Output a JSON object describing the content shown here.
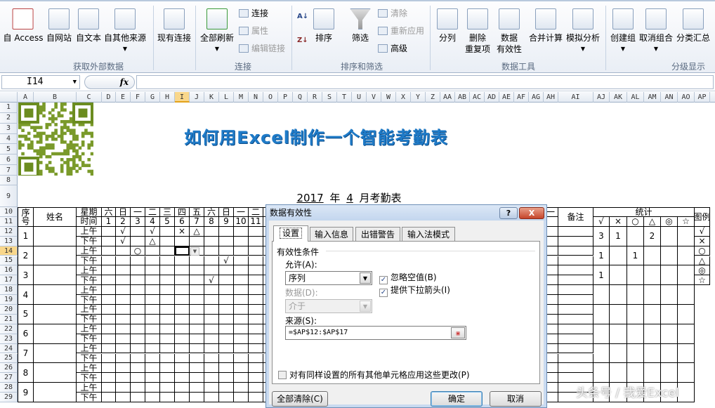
{
  "ribbon": {
    "buttons": [
      {
        "id": "from-access",
        "label": "自 Access"
      },
      {
        "id": "from-web",
        "label": "自网站"
      },
      {
        "id": "from-text",
        "label": "自文本"
      },
      {
        "id": "from-other",
        "label": "自其他来源"
      },
      {
        "id": "existing-connections",
        "label": "现有连接"
      },
      {
        "id": "refresh-all",
        "label": "全部刷新"
      },
      {
        "id": "sort",
        "label": "排序"
      },
      {
        "id": "filter",
        "label": "筛选"
      },
      {
        "id": "text-to-columns",
        "label": "分列"
      },
      {
        "id": "remove-duplicates",
        "label": "删除\n重复项"
      },
      {
        "id": "data-validation",
        "label": "数据\n有效性"
      },
      {
        "id": "consolidate",
        "label": "合并计算"
      },
      {
        "id": "what-if",
        "label": "模拟分析"
      },
      {
        "id": "group",
        "label": "创建组"
      },
      {
        "id": "ungroup",
        "label": "取消组合"
      },
      {
        "id": "subtotal",
        "label": "分类汇总"
      }
    ],
    "small": {
      "connections": "连接",
      "properties": "属性",
      "edit_links": "编辑链接",
      "clear": "清除",
      "reapply": "重新应用",
      "advanced": "高级"
    },
    "groups": [
      "获取外部数据",
      "连接",
      "排序和筛选",
      "数据工具",
      "分级显示"
    ]
  },
  "formula_bar": {
    "name_box": "I14",
    "fx": "fx",
    "value": ""
  },
  "columns": [
    "A",
    "B",
    "C",
    "D",
    "E",
    "F",
    "G",
    "H",
    "I",
    "J",
    "K",
    "L",
    "M",
    "N",
    "O",
    "P",
    "Q",
    "R",
    "S",
    "T",
    "U",
    "V",
    "W",
    "X",
    "Y",
    "Z",
    "AA",
    "AB",
    "AC",
    "AD",
    "AE",
    "AF",
    "AG",
    "AH",
    "AI",
    "AJ",
    "AK",
    "AL",
    "AM",
    "AN",
    "AO",
    "AP"
  ],
  "rows": [
    "1",
    "2",
    "3",
    "4",
    "5",
    "6",
    "7",
    "8",
    "9",
    "10",
    "11",
    "12",
    "13",
    "14",
    "15",
    "16",
    "17",
    "18",
    "19",
    "20",
    "21",
    "22",
    "23",
    "24",
    "25",
    "26",
    "27",
    "28",
    "29"
  ],
  "selected_cell": "I14",
  "sheet": {
    "title": "如何用Excel制作一个智能考勤表",
    "subtitle": {
      "year": "2017",
      "year_suffix": "年",
      "month": "4",
      "month_suffix": "月考勤表"
    },
    "cells": {
      "A10": "序号",
      "B10": "姓名",
      "C10": "星期",
      "C11": "时间",
      "D10": "六",
      "E10": "日",
      "F10": "一",
      "G10": "二",
      "H10": "三",
      "I10": "四",
      "J10": "五",
      "K10": "六",
      "L10": "日",
      "M10": "一",
      "N10": "二",
      "AH10": "一",
      "D11": "1",
      "E11": "2",
      "F11": "3",
      "G11": "4",
      "H11": "5",
      "I11": "6",
      "J11": "7",
      "K11": "8",
      "L11": "9",
      "M11": "10",
      "N11": "11",
      "A12": "1",
      "A14": "2",
      "A16": "3",
      "A18": "4",
      "A20": "5",
      "A22": "6",
      "A24": "7",
      "A26": "8",
      "A28": "9",
      "C12": "上午",
      "C13": "下午",
      "C14": "上午",
      "C15": "下午",
      "C16": "上午",
      "C17": "下午",
      "C18": "上午",
      "C19": "下午",
      "C20": "上午",
      "C21": "下午",
      "C22": "上午",
      "C23": "下午",
      "C24": "上午",
      "C25": "下午",
      "C26": "上午",
      "C27": "下午",
      "C28": "上午",
      "C29": "下午",
      "E12": "√",
      "G12": "√",
      "I12": "×",
      "J12": "△",
      "E13": "√",
      "G13": "△",
      "F14": "○",
      "L15": "√",
      "K17": "√",
      "AI10": "备注",
      "AJ10": "统计",
      "AJ11": "√",
      "AK11": "×",
      "AL11": "○",
      "AM11": "△",
      "AN11": "◎",
      "AO11": "☆",
      "AP10": "图例",
      "AJ12": "3",
      "AK12": "1",
      "AM12": "2",
      "AJ14": "1",
      "AL14": "1",
      "AJ16": "1",
      "AP12": "√",
      "AP13": "×",
      "AP14": "○",
      "AP15": "△",
      "AP16": "◎",
      "AP17": "☆"
    }
  },
  "dialog": {
    "title": "数据有效性",
    "help": "?",
    "close": "X",
    "tabs": [
      "设置",
      "输入信息",
      "出错警告",
      "输入法模式"
    ],
    "section": "有效性条件",
    "allow_label": "允许(A):",
    "allow_value": "序列",
    "ignore_blank": {
      "label": "忽略空值(B)",
      "checked": true
    },
    "in_cell_dropdown": {
      "label": "提供下拉箭头(I)",
      "checked": true
    },
    "data_label": "数据(D):",
    "data_value": "介于",
    "source_label": "来源(S):",
    "source_value": "=$AP$12:$AP$17",
    "apply_all": {
      "label": "对有同样设置的所有其他单元格应用这些更改(P)",
      "checked": false
    },
    "clear_all": "全部清除(C)",
    "ok": "确定",
    "cancel": "取消"
  },
  "watermark": "头条号 / 我爱Excel"
}
